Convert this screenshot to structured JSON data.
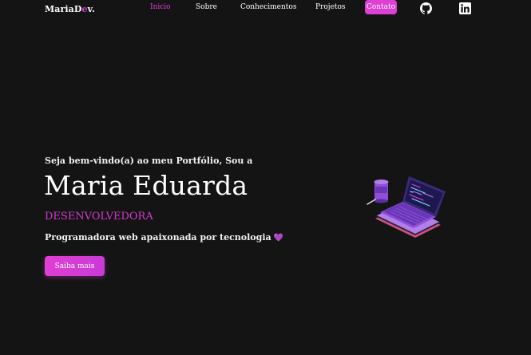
{
  "header": {
    "logo_main": "MariaD",
    "logo_accent": "e",
    "logo_end": "v.",
    "nav": {
      "inicio": "Inicio",
      "sobre": "Sobre",
      "conhecimentos": "Conhecimentos",
      "projetos": "Projetos",
      "contato": "Contato"
    },
    "icons": {
      "github": "github-icon",
      "linkedin": "linkedin-icon"
    }
  },
  "hero": {
    "greeting": "Seja bem-vindo(a) ao meu Portfólio, Sou a",
    "name": "Maria Eduarda",
    "role": "DESENVOLVEDORA",
    "tagline": "Programadora web apaixonada por tecnologia",
    "heart": "💜",
    "cta_label": "Saiba mais",
    "illustration": "laptop-coffee-illustration"
  },
  "colors": {
    "background": "#141414",
    "accent": "#e03fd3",
    "text": "#ffffff"
  }
}
